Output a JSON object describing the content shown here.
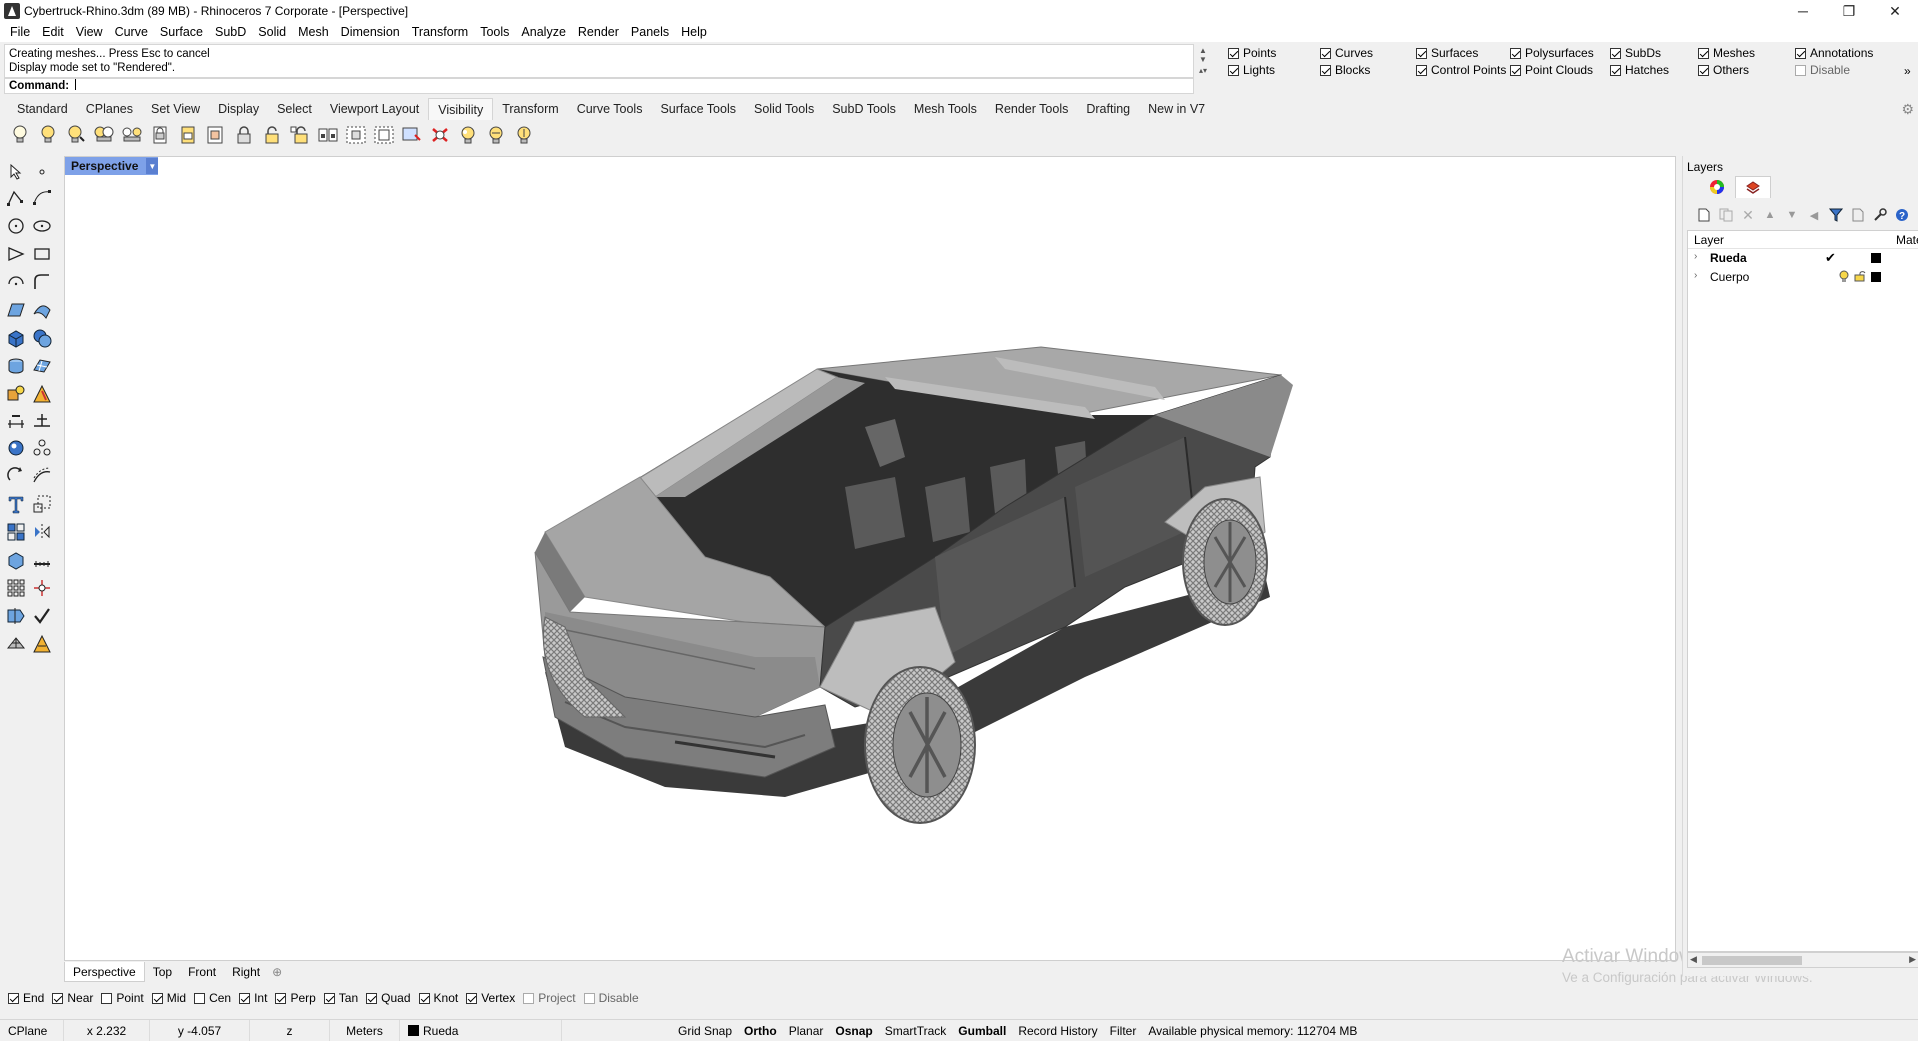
{
  "window": {
    "title": "Cybertruck-Rhino.3dm (89 MB) - Rhinoceros 7 Corporate - [Perspective]",
    "controls": [
      "─",
      "❐",
      "✕"
    ]
  },
  "menu": [
    "File",
    "Edit",
    "View",
    "Curve",
    "Surface",
    "SubD",
    "Solid",
    "Mesh",
    "Dimension",
    "Transform",
    "Tools",
    "Analyze",
    "Render",
    "Panels",
    "Help"
  ],
  "command": {
    "history": [
      "Creating meshes... Press Esc to cancel",
      "Display mode set to \"Rendered\"."
    ],
    "prompt_label": "Command:"
  },
  "visibility": {
    "items": [
      {
        "label": "Points",
        "checked": true
      },
      {
        "label": "Curves",
        "checked": true
      },
      {
        "label": "Surfaces",
        "checked": true
      },
      {
        "label": "Polysurfaces",
        "checked": true
      },
      {
        "label": "SubDs",
        "checked": true
      },
      {
        "label": "Meshes",
        "checked": true
      },
      {
        "label": "Annotations",
        "checked": true
      },
      {
        "label": "Lights",
        "checked": true
      },
      {
        "label": "Blocks",
        "checked": true
      },
      {
        "label": "Control Points",
        "checked": true
      },
      {
        "label": "Point Clouds",
        "checked": true
      },
      {
        "label": "Hatches",
        "checked": true
      },
      {
        "label": "Others",
        "checked": true
      },
      {
        "label": "Disable",
        "checked": false
      }
    ],
    "more": "»"
  },
  "toolbar_tabs": [
    "Standard",
    "CPlanes",
    "Set View",
    "Display",
    "Select",
    "Viewport Layout",
    "Visibility",
    "Transform",
    "Curve Tools",
    "Surface Tools",
    "Solid Tools",
    "SubD Tools",
    "Mesh Tools",
    "Render Tools",
    "Drafting",
    "New in V7"
  ],
  "active_tab": "Visibility",
  "viewport": {
    "label": "Perspective",
    "tabs": [
      "Perspective",
      "Top",
      "Front",
      "Right"
    ],
    "add_tab": "⊕"
  },
  "watermark": {
    "line1": "Activar Windows",
    "line2": "Ve a Configuración para activar Windows."
  },
  "osnap": [
    {
      "label": "End",
      "checked": true
    },
    {
      "label": "Near",
      "checked": true
    },
    {
      "label": "Point",
      "checked": false
    },
    {
      "label": "Mid",
      "checked": true
    },
    {
      "label": "Cen",
      "checked": false
    },
    {
      "label": "Int",
      "checked": true
    },
    {
      "label": "Perp",
      "checked": true
    },
    {
      "label": "Tan",
      "checked": true
    },
    {
      "label": "Quad",
      "checked": true
    },
    {
      "label": "Knot",
      "checked": true
    },
    {
      "label": "Vertex",
      "checked": true
    },
    {
      "label": "Project",
      "checked": false,
      "disabled": true
    },
    {
      "label": "Disable",
      "checked": false,
      "disabled": true
    }
  ],
  "status": {
    "cplane": "CPlane",
    "x": "x 2.232",
    "y": "y -4.057",
    "z": "z",
    "units": "Meters",
    "layer": "Rueda",
    "panes": [
      "Grid Snap",
      "Ortho",
      "Planar",
      "Osnap",
      "SmartTrack",
      "Gumball",
      "Record History",
      "Filter"
    ],
    "bold_panes": [
      "Ortho",
      "Osnap",
      "Gumball"
    ],
    "memory": "Available physical memory: 112704 MB"
  },
  "layers_panel": {
    "title": "Layers",
    "col_layer": "Layer",
    "col_material": "Mate",
    "rows": [
      {
        "name": "Rueda",
        "current": true,
        "bold": true
      },
      {
        "name": "Cuerpo",
        "current": false,
        "bold": false
      }
    ]
  },
  "colors": {
    "viewport_label_bg": "#7ea1e8",
    "layer_color": "#000000"
  }
}
